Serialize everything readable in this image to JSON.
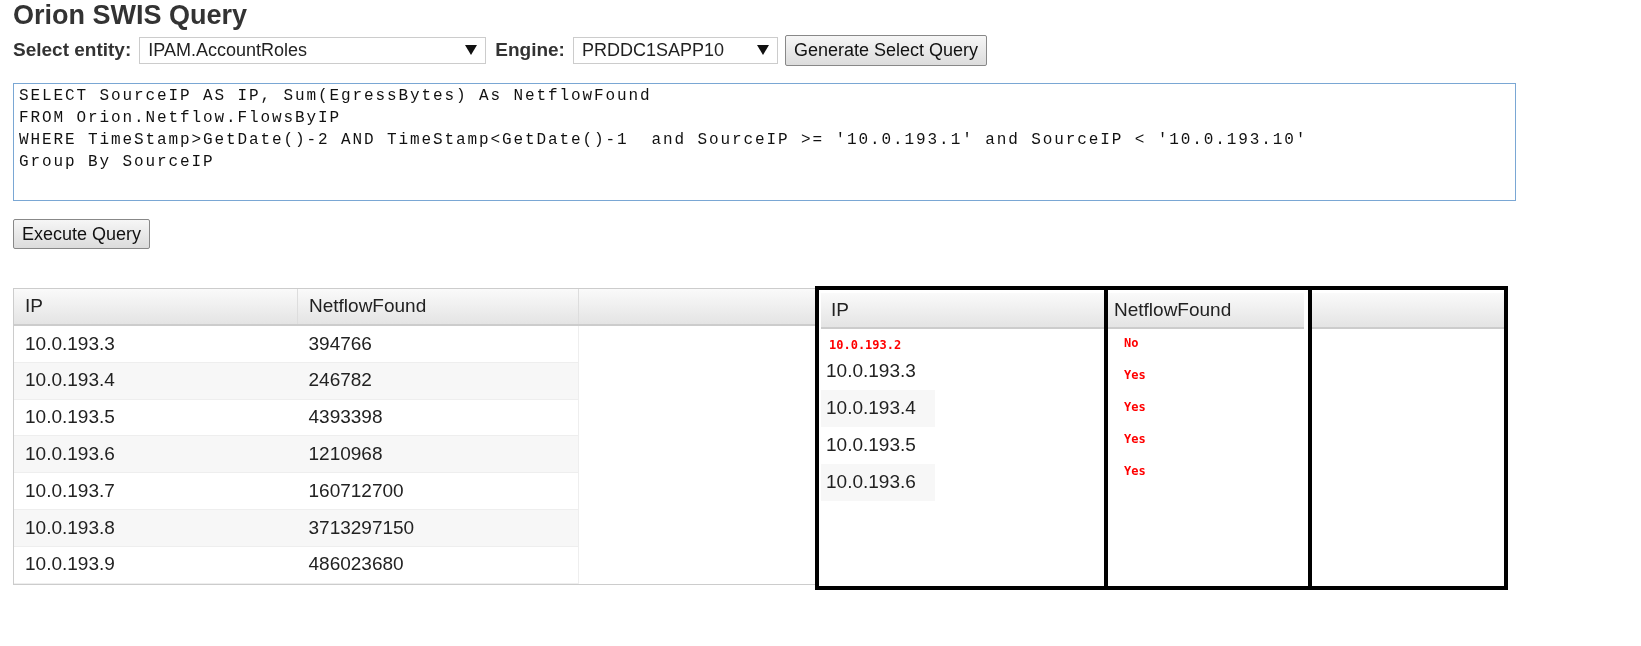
{
  "page_title": "Orion SWIS Query",
  "entity": {
    "label": "Select entity:",
    "value": "IPAM.AccountRoles"
  },
  "engine": {
    "label": "Engine:",
    "value": "PRDDC1SAPP10"
  },
  "generate_button": "Generate Select Query",
  "query_lines": [
    "SELECT SourceIP AS IP, Sum(EgressBytes) As NetflowFound",
    "FROM Orion.Netflow.FlowsByIP",
    "WHERE TimeStamp>GetDate()-2 AND TimeStamp<GetDate()-1  and SourceIP >= '10.0.193.1' and SourceIP < '10.0.193.10'",
    "Group By SourceIP"
  ],
  "execute_button": "Execute Query",
  "results_table": {
    "columns": [
      "IP",
      "NetflowFound"
    ],
    "rows": [
      [
        "10.0.193.3",
        "394766"
      ],
      [
        "10.0.193.4",
        "246782"
      ],
      [
        "10.0.193.5",
        "4393398"
      ],
      [
        "10.0.193.6",
        "1210968"
      ],
      [
        "10.0.193.7",
        "160712700"
      ],
      [
        "10.0.193.8",
        "3713297150"
      ],
      [
        "10.0.193.9",
        "486023680"
      ]
    ]
  },
  "annotated_table": {
    "columns": [
      "IP",
      "NetflowFound"
    ],
    "ip_note": "10.0.193.2",
    "rows": [
      "10.0.193.3",
      "10.0.193.4",
      "10.0.193.5",
      "10.0.193.6"
    ],
    "found_notes": [
      "No",
      "Yes",
      "Yes",
      "Yes",
      "Yes"
    ]
  }
}
